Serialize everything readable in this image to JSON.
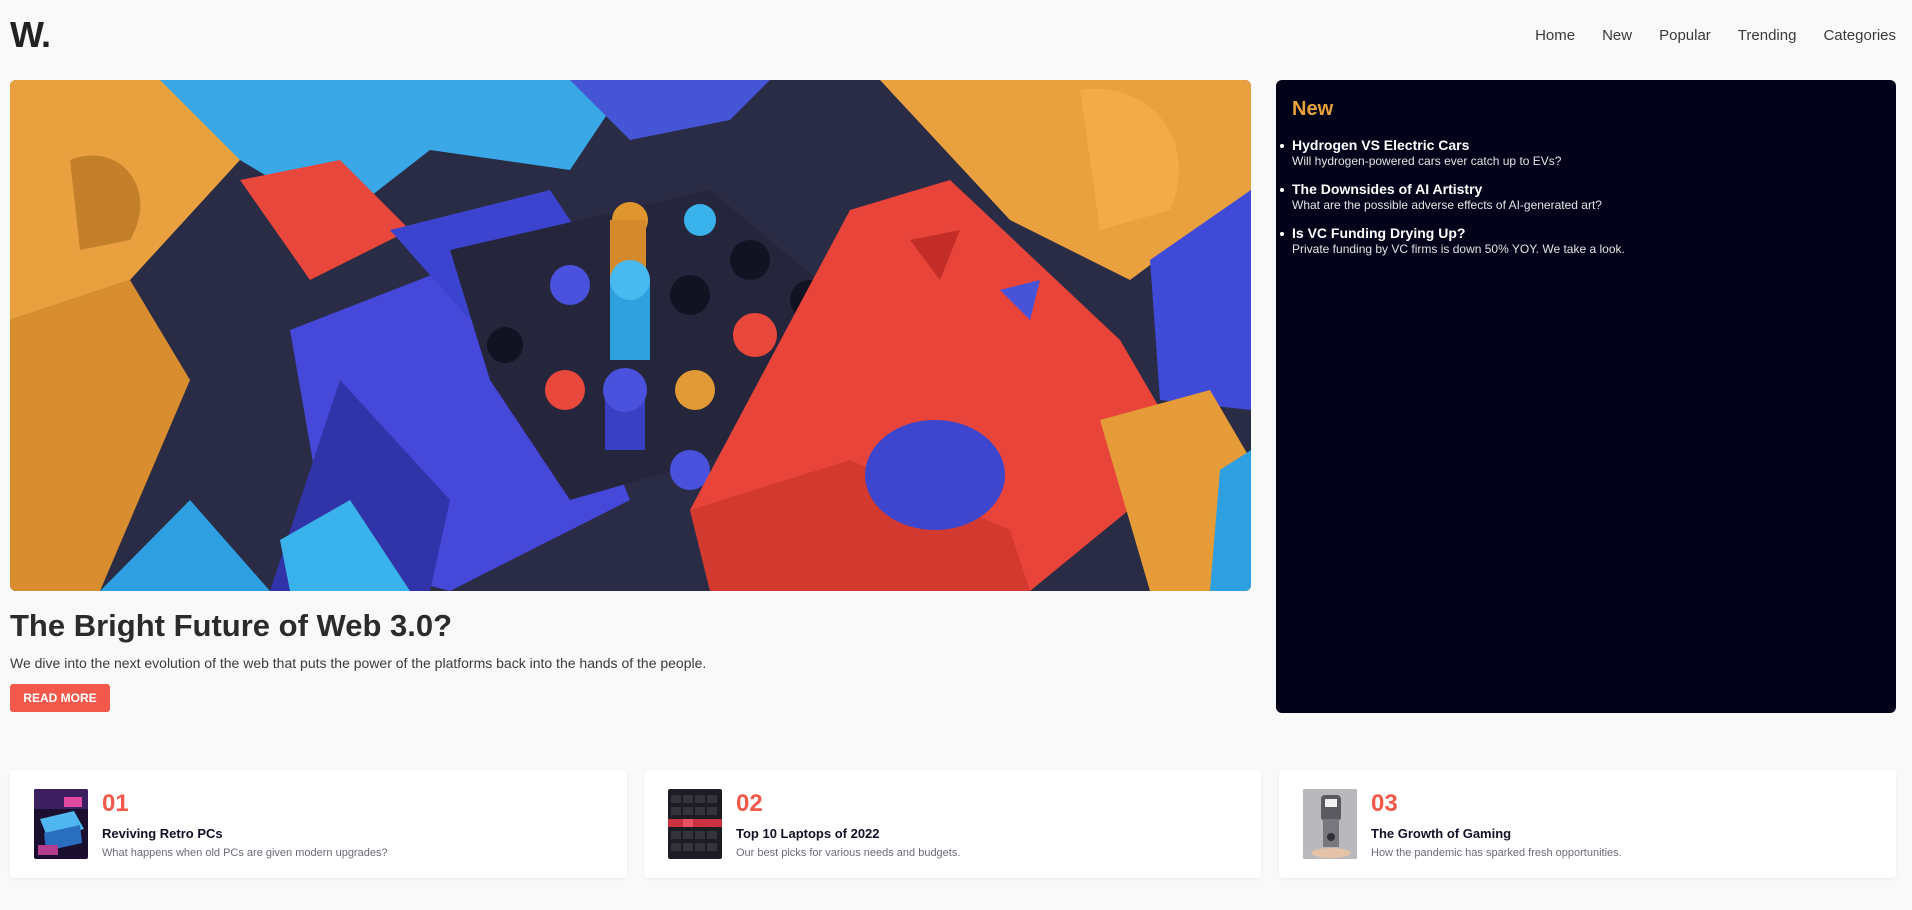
{
  "header": {
    "logo": "W.",
    "nav": [
      "Home",
      "New",
      "Popular",
      "Trending",
      "Categories"
    ]
  },
  "hero": {
    "title": "The Bright Future of Web 3.0?",
    "description": "We dive into the next evolution of the web that puts the power of the platforms back into the hands of the people.",
    "button_label": "READ MORE"
  },
  "new_panel": {
    "title": "New",
    "items": [
      {
        "title": "Hydrogen VS Electric Cars",
        "desc": "Will hydrogen-powered cars ever catch up to EVs?"
      },
      {
        "title": "The Downsides of AI Artistry",
        "desc": "What are the possible adverse effects of AI-generated art?"
      },
      {
        "title": "Is VC Funding Drying Up?",
        "desc": "Private funding by VC firms is down 50% YOY. We take a look."
      }
    ]
  },
  "cards": [
    {
      "num": "01",
      "title": "Reviving Retro PCs",
      "desc": "What happens when old PCs are given modern upgrades?"
    },
    {
      "num": "02",
      "title": "Top 10 Laptops of 2022",
      "desc": "Our best picks for various needs and budgets."
    },
    {
      "num": "03",
      "title": "The Growth of Gaming",
      "desc": "How the pandemic has sparked fresh opportunities."
    }
  ],
  "colors": {
    "accent": "#f2594b",
    "panel_bg": "#020219",
    "panel_title": "#e9a23b"
  }
}
